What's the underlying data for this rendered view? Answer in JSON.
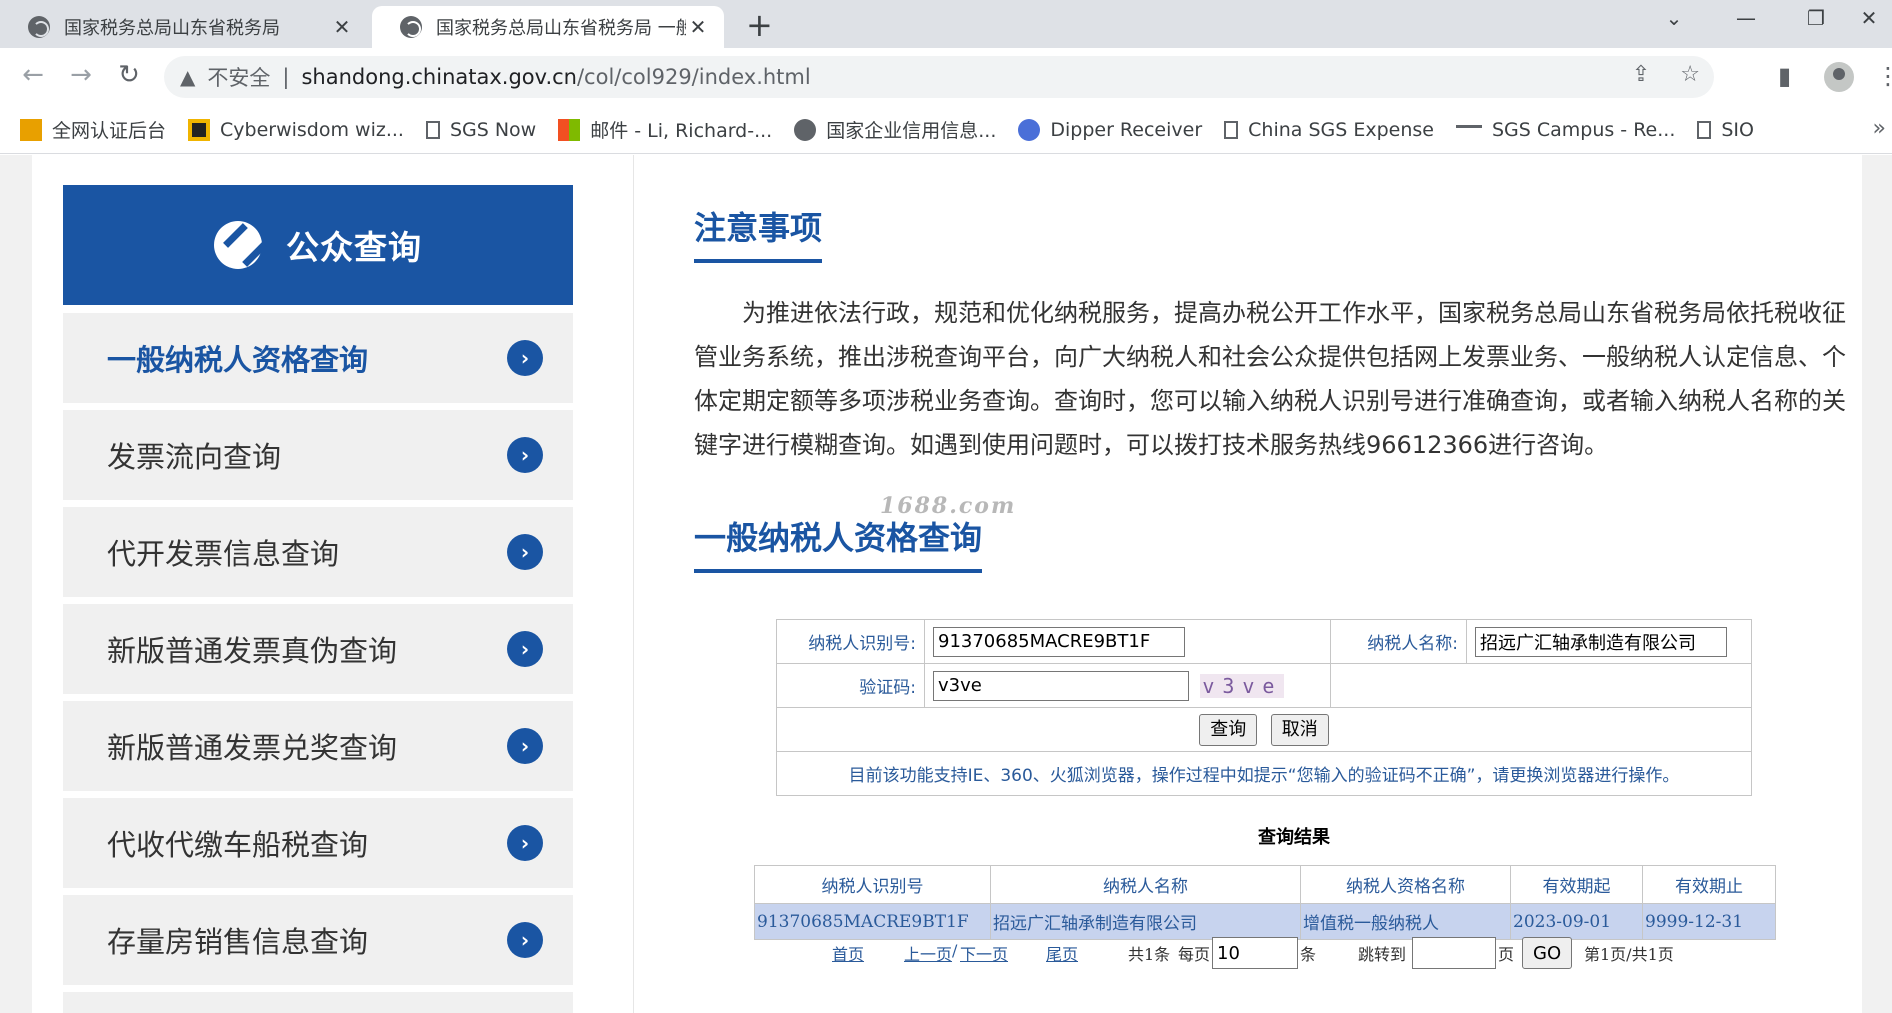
{
  "browser": {
    "tabs": [
      {
        "title": "国家税务总局山东省税务局",
        "active": false
      },
      {
        "title": "国家税务总局山东省税务局 一般纳",
        "active": true
      }
    ],
    "address": {
      "security_label": "不安全",
      "host": "shandong.chinatax.gov.cn",
      "path": "/col/col929/index.html"
    },
    "bookmarks": [
      {
        "label": "全网认证后台",
        "icon": "app-icon",
        "color": "#e8a000"
      },
      {
        "label": "Cyberwisdom wiz...",
        "icon": "cyberwisdom-icon",
        "color": "#f0b400"
      },
      {
        "label": "SGS Now",
        "icon": "page-icon",
        "color": "#5f6368"
      },
      {
        "label": "邮件 - Li, Richard-...",
        "icon": "microsoft-icon",
        "color": "#00a4ef"
      },
      {
        "label": "国家企业信用信息...",
        "icon": "globe-icon",
        "color": "#5f6368"
      },
      {
        "label": "Dipper Receiver",
        "icon": "lock-icon",
        "color": "#4a6fd8"
      },
      {
        "label": "China SGS Expense",
        "icon": "page-icon",
        "color": "#5f6368"
      },
      {
        "label": "SGS Campus - Re...",
        "icon": "sgs-icon",
        "color": "#5f6368"
      },
      {
        "label": "SIO",
        "icon": "page-icon",
        "color": "#5f6368"
      }
    ]
  },
  "sidebar": {
    "title": "公众查询",
    "items": [
      {
        "label": "一般纳税人资格查询",
        "active": true
      },
      {
        "label": "发票流向查询",
        "active": false
      },
      {
        "label": "代开发票信息查询",
        "active": false
      },
      {
        "label": "新版普通发票真伪查询",
        "active": false
      },
      {
        "label": "新版普通发票兑奖查询",
        "active": false
      },
      {
        "label": "代收代缴车船税查询",
        "active": false
      },
      {
        "label": "存量房销售信息查询",
        "active": false
      }
    ]
  },
  "notice": {
    "title": "注意事项",
    "text": "为推进依法行政，规范和优化纳税服务，提高办税公开工作水平，国家税务总局山东省税务局依托税收征管业务系统，推出涉税查询平台，向广大纳税人和社会公众提供包括网上发票业务、一般纳税人认定信息、个体定期定额等多项涉税业务查询。查询时，您可以输入纳税人识别号进行准确查询，或者输入纳税人名称的关键字进行模糊查询。如遇到使用问题时，可以拨打技术服务热线96612366进行咨询。"
  },
  "watermark": "1688.com",
  "query": {
    "title": "一般纳税人资格查询",
    "taxpayer_id_label": "纳税人识别号:",
    "taxpayer_id_value": "91370685MACRE9BT1F",
    "taxpayer_name_label": "纳税人名称:",
    "taxpayer_name_value": "招远广汇轴承制造有限公司",
    "captcha_label": "验证码:",
    "captcha_value": "v3ve",
    "captcha_image_text": "v3ve",
    "submit_label": "查询",
    "cancel_label": "取消",
    "tip": "目前该功能支持IE、360、火狐浏览器，操作过程中如提示“您输入的验证码不正确”，请更换浏览器进行操作。"
  },
  "results": {
    "title": "查询结果",
    "columns": [
      "纳税人识别号",
      "纳税人名称",
      "纳税人资格名称",
      "有效期起",
      "有效期止"
    ],
    "rows": [
      [
        "91370685MACRE9BT1F",
        "招远广汇轴承制造有限公司",
        "增值税一般纳税人",
        "2023-09-01",
        "9999-12-31"
      ]
    ]
  },
  "pager": {
    "first": "首页",
    "prev": "上一页",
    "slash": "/",
    "next": "下一页",
    "last": "尾页",
    "total_prefix": "共1条",
    "per_page_label": "每页",
    "per_page_value": "10",
    "per_page_unit": "条",
    "jump_label": "跳转到",
    "jump_value": "",
    "page_unit": "页",
    "go_label": "GO",
    "status": "第1页/共1页"
  },
  "colors": {
    "brand": "#1a55a3",
    "row_highlight": "#c7d3ee"
  }
}
